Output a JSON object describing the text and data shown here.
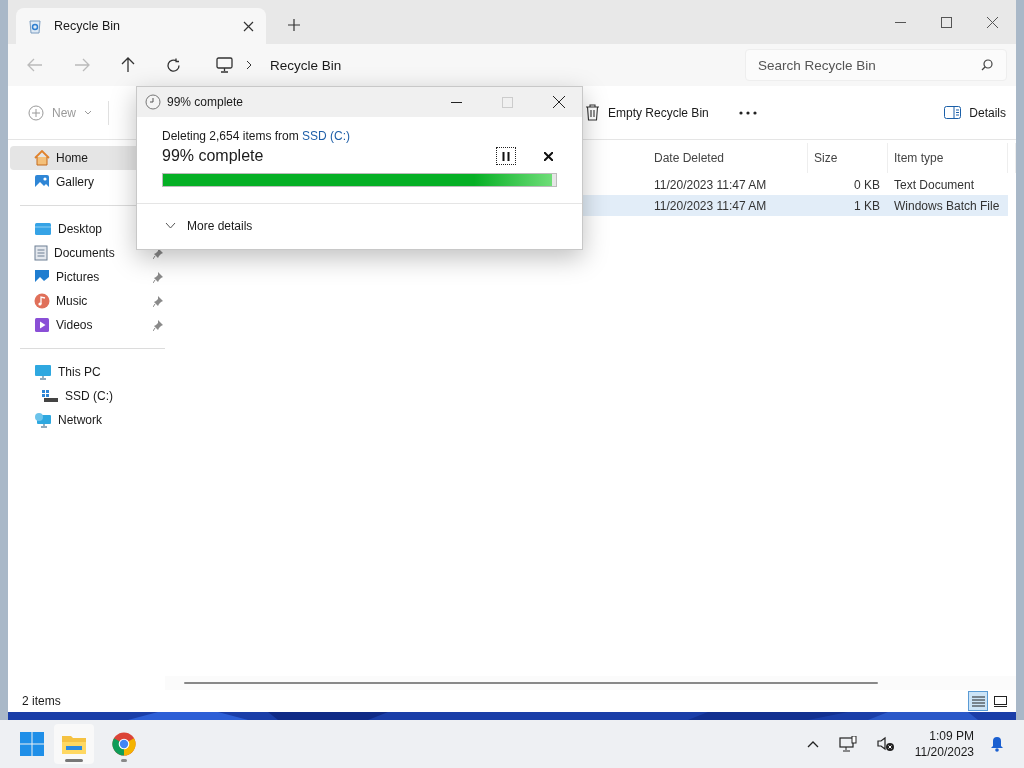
{
  "window": {
    "tabs": [
      {
        "title": "Recycle Bin"
      }
    ]
  },
  "address": {
    "crumbs": [
      "Recycle Bin"
    ]
  },
  "search": {
    "placeholder": "Search Recycle Bin"
  },
  "toolbar": {
    "new": {
      "label": "New",
      "disabled": true
    },
    "empty": {
      "label": "Empty Recycle Bin"
    },
    "details": {
      "label": "Details"
    }
  },
  "sidebar": {
    "sections": [
      [
        {
          "label": "Home",
          "selected": true
        },
        {
          "label": "Gallery",
          "selected": false
        }
      ],
      [
        {
          "label": "Desktop",
          "selected": false
        },
        {
          "label": "Documents",
          "selected": false,
          "pinned": true
        },
        {
          "label": "Pictures",
          "selected": false,
          "pinned": true
        },
        {
          "label": "Music",
          "selected": false,
          "pinned": true
        },
        {
          "label": "Videos",
          "selected": false,
          "pinned": true
        }
      ],
      [
        {
          "label": "This PC",
          "selected": false,
          "children": [
            {
              "label": "SSD (C:)",
              "selected": false
            }
          ]
        },
        {
          "label": "Network",
          "selected": false
        }
      ]
    ]
  },
  "table": {
    "columns": [
      "Date Deleted",
      "Size",
      "Item type"
    ],
    "rows": [
      {
        "date_deleted": "11/20/2023 11:47 AM",
        "size": "0 KB",
        "item_type": "Text Document",
        "selected": false
      },
      {
        "date_deleted": "11/20/2023 11:47 AM",
        "size": "1 KB",
        "item_type": "Windows Batch File",
        "selected": true
      }
    ]
  },
  "status_bar": {
    "count": "2 items",
    "views": [
      {
        "selected": true
      },
      {
        "selected": false
      }
    ]
  },
  "dialog": {
    "title": "99% complete",
    "message": "Deleting 2,654 items from ",
    "link": "SSD (C:)",
    "heading": "99% complete",
    "level": 0.99,
    "details": "More details",
    "expanded": false
  },
  "taskbar": {
    "apps": [
      {
        "selected": true
      },
      {
        "selected": false
      }
    ],
    "time": "1:09 PM",
    "date": "11/20/2023"
  }
}
